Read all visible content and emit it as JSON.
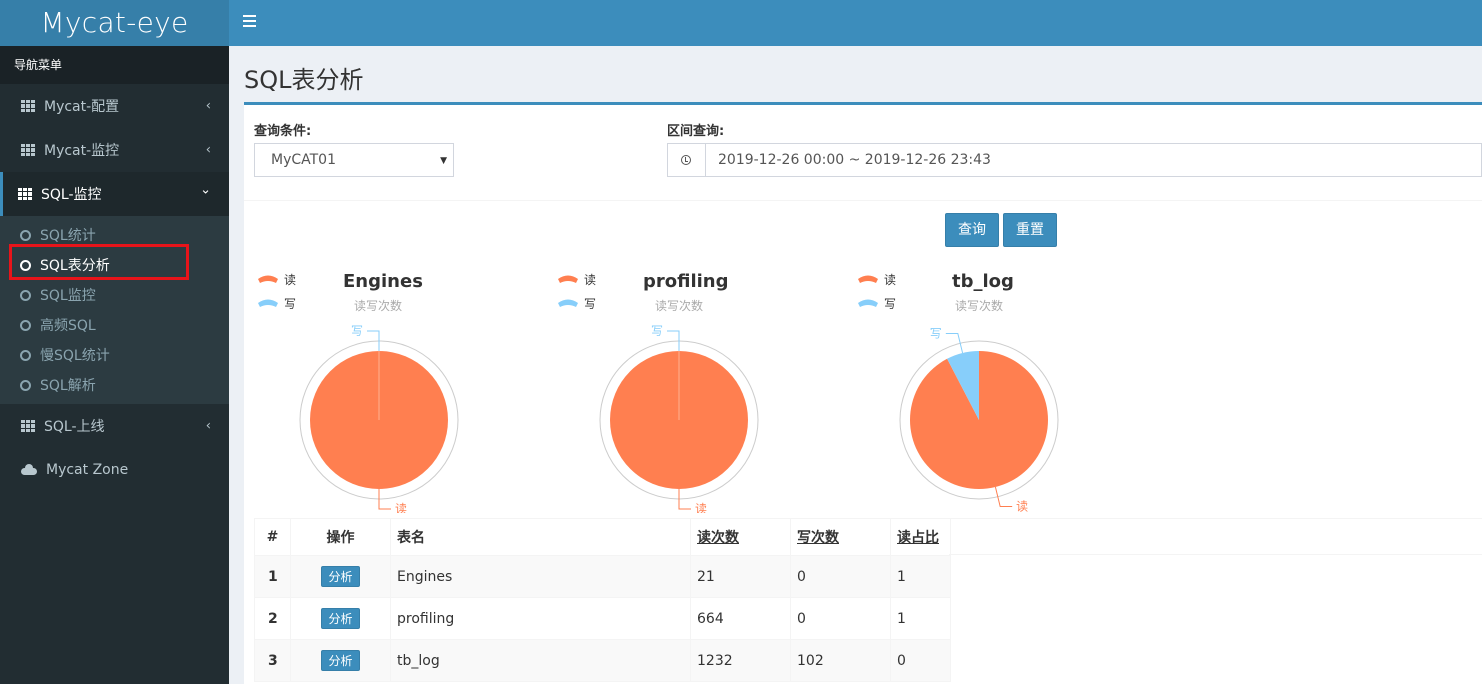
{
  "app": {
    "title": "Mycat-eye"
  },
  "sidebar": {
    "header": "导航菜单",
    "items": [
      {
        "label": "Mycat-配置",
        "chevron": "‹"
      },
      {
        "label": "Mycat-监控",
        "chevron": "‹"
      },
      {
        "label": "SQL-监控",
        "chevron": "⌄"
      },
      {
        "label": "SQL-上线",
        "chevron": "‹"
      },
      {
        "label": "Mycat Zone"
      }
    ],
    "submenu": [
      {
        "label": "SQL统计"
      },
      {
        "label": "SQL表分析"
      },
      {
        "label": "SQL监控"
      },
      {
        "label": "高频SQL"
      },
      {
        "label": "慢SQL统计"
      },
      {
        "label": "SQL解析"
      }
    ]
  },
  "page": {
    "title": "SQL表分析"
  },
  "filters": {
    "query_label": "查询条件:",
    "select_value": "MyCAT01",
    "range_label": "区间查询:",
    "range_value": "2019-12-26 00:00 ~ 2019-12-26 23:43"
  },
  "buttons": {
    "search": "查询",
    "reset": "重置"
  },
  "colors": {
    "read": "#ff7f50",
    "write": "#87cefa",
    "accent": "#3c8dbc"
  },
  "chart_data": [
    {
      "type": "pie",
      "title": "Engines",
      "subtitle": "读写次数",
      "legend": [
        "读",
        "写"
      ],
      "values": [
        21,
        0
      ],
      "labels": [
        "读",
        "写"
      ]
    },
    {
      "type": "pie",
      "title": "profiling",
      "subtitle": "读写次数",
      "legend": [
        "读",
        "写"
      ],
      "values": [
        664,
        0
      ],
      "labels": [
        "读",
        "写"
      ]
    },
    {
      "type": "pie",
      "title": "tb_log",
      "subtitle": "读写次数",
      "legend": [
        "读",
        "写"
      ],
      "values": [
        1232,
        102
      ],
      "labels": [
        "读",
        "写"
      ]
    }
  ],
  "table": {
    "headers": [
      "#",
      "操作",
      "表名",
      "读次数",
      "写次数",
      "读占比"
    ],
    "action_label": "分析",
    "rows": [
      {
        "idx": "1",
        "name": "Engines",
        "reads": "21",
        "writes": "0",
        "ratio": "1"
      },
      {
        "idx": "2",
        "name": "profiling",
        "reads": "664",
        "writes": "0",
        "ratio": "1"
      },
      {
        "idx": "3",
        "name": "tb_log",
        "reads": "1232",
        "writes": "102",
        "ratio": "0"
      }
    ]
  }
}
